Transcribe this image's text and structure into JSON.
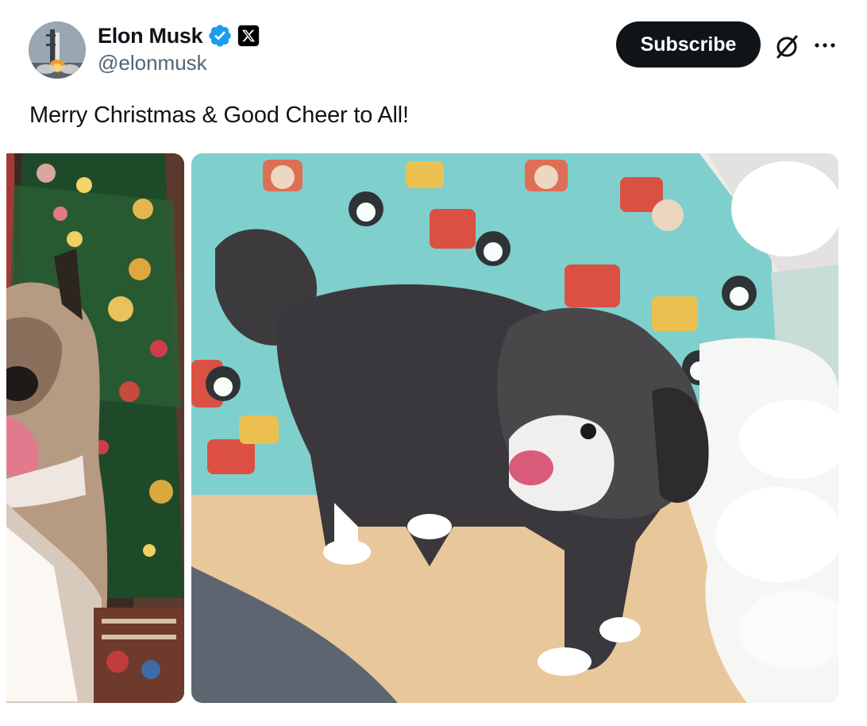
{
  "author": {
    "display_name": "Elon Musk",
    "handle": "@elonmusk",
    "avatar_icon": "rocket-launch-avatar",
    "verified_icon": "verified-badge-icon",
    "affiliate_icon": "x-logo-icon"
  },
  "header": {
    "subscribe_label": "Subscribe",
    "grok_icon": "grok-icon",
    "more_icon": "more-options-icon"
  },
  "post": {
    "text": "Merry Christmas & Good Cheer to All!"
  },
  "media": [
    {
      "description_icon": "photo",
      "subject": "dog-by-christmas-tree"
    },
    {
      "description_icon": "photo",
      "subject": "dog-by-presents"
    }
  ],
  "colors": {
    "verified_blue": "#1d9bf0",
    "text_primary": "#0f1419",
    "text_secondary": "#536471",
    "button_bg": "#0f1419"
  }
}
